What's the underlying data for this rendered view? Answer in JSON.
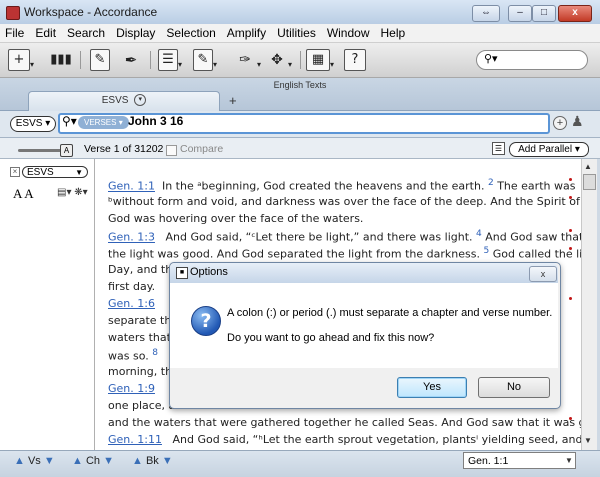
{
  "window": {
    "title": "Workspace - Accordance",
    "buttons": {
      "close": "x"
    }
  },
  "menu": [
    "File",
    "Edit",
    "Search",
    "Display",
    "Selection",
    "Amplify",
    "Utilities",
    "Window",
    "Help"
  ],
  "tabs": {
    "group_label": "English Texts",
    "active": "ESVS",
    "add_symbol": "+"
  },
  "search": {
    "module": "ESVS",
    "mode": "VERSES",
    "query": "John 3 16"
  },
  "status": {
    "verse_count": "Verse 1 of 31202",
    "compare_label": "Compare",
    "add_parallel": "Add Parallel"
  },
  "left_pane": {
    "module": "ESVS",
    "font_size_label": "A A"
  },
  "text_lines": [
    {
      "ref": "Gen. 1:1",
      "text": "In the ᵃbeginning, God created the heavens and the earth.",
      "vnum": "2",
      "tail": "The earth was"
    },
    {
      "text": "ᵇwithout form and void, and darkness was over the face of the deep. And the Spirit of"
    },
    {
      "text": "God was hovering over the face of the waters."
    },
    {
      "ref": "Gen. 1:3",
      "text": "And God said, “ᶜLet there be light,” and there was light.",
      "vnum": "4",
      "tail": "And God saw that"
    },
    {
      "text": "the light was good. And God separated the light from the darkness.",
      "vnum": "5",
      "tail": "God called the light"
    },
    {
      "text": "Day, and the"
    },
    {
      "text": "first day."
    },
    {
      "ref": "Gen. 1:6"
    },
    {
      "text": "separate the"
    },
    {
      "text": "waters that"
    },
    {
      "text": "was so.",
      "vnum": "8"
    },
    {
      "text": "morning, th"
    },
    {
      "ref": "Gen. 1:9"
    },
    {
      "text": "one place, a"
    },
    {
      "text": "and the waters that were gathered together he called Seas. And God saw that it was good."
    },
    {
      "ref": "Gen. 1:11",
      "text": "And God said, “ʰLet the earth sprout vegetation, plantsⁱ yielding seed, and"
    }
  ],
  "bottom": {
    "nav": [
      {
        "label": "Vs"
      },
      {
        "label": "Ch"
      },
      {
        "label": "Bk"
      }
    ],
    "goto": "Gen. 1:1"
  },
  "dialog": {
    "title": "Options",
    "close": "x",
    "message1": "A colon (:) or period (.) must separate a chapter and verse number.",
    "message2": "Do you want to go ahead and fix this now?",
    "yes": "Yes",
    "no": "No"
  },
  "colors": {
    "accent": "#2f61b8",
    "marker": "#c21818",
    "focus": "#5b95d6"
  }
}
